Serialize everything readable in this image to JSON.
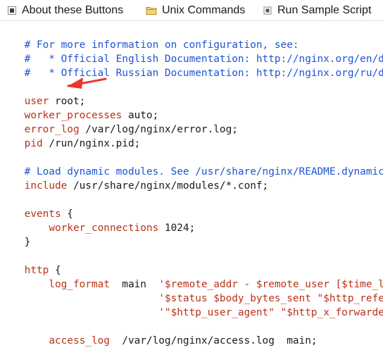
{
  "toolbar": {
    "buttons": [
      {
        "label": "About these Buttons",
        "icon": "checkbox-icon"
      },
      {
        "label": "Unix Commands",
        "icon": "folder-icon"
      },
      {
        "label": "Run Sample Script",
        "icon": "script-icon"
      }
    ]
  },
  "editor": {
    "lines": [
      {
        "comment": "# For more information on configuration, see:"
      },
      {
        "comment": "#   * Official English Documentation: http://nginx.org/en/doc"
      },
      {
        "comment": "#   * Official Russian Documentation: http://nginx.org/ru/doc"
      },
      {
        "keyword": "user",
        "value": " root;"
      },
      {
        "keyword": "worker_processes",
        "value": " auto;"
      },
      {
        "keyword": "error_log",
        "value": " /var/log/nginx/error.log;"
      },
      {
        "keyword": "pid",
        "value": " /run/nginx.pid;"
      },
      {
        "comment": "# Load dynamic modules. See /usr/share/nginx/README.dynamic."
      },
      {
        "keyword": "include",
        "value": " /usr/share/nginx/modules/*.conf;"
      },
      {
        "keyword": "events",
        "value": " {"
      },
      {
        "indent": "    ",
        "keyword": "worker_connections",
        "value": " 1024;"
      },
      {
        "value": "}"
      },
      {
        "keyword": "http",
        "value": " {"
      },
      {
        "indent": "    ",
        "keyword": "log_format",
        "value": "  main  ",
        "string": "'$remote_addr - $remote_user [$time_loc"
      },
      {
        "indent": "                      ",
        "string": "'$status $body_bytes_sent \"$http_refere"
      },
      {
        "indent": "                      ",
        "string": "'\"$http_user_agent\" \"$http_x_forwarded_"
      },
      {
        "indent": "    ",
        "keyword": "access_log",
        "value": "  /var/log/nginx/access.log  main;"
      }
    ]
  },
  "annotation": {
    "color": "#e8372c"
  },
  "colors": {
    "comment": "#1e54d6",
    "keyword": "#b8321a",
    "text": "#1a1a1a"
  }
}
